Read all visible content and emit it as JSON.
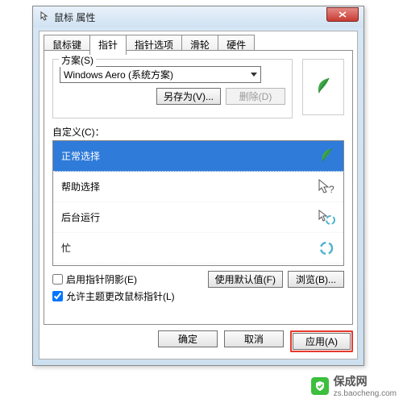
{
  "window": {
    "title": "鼠标 属性"
  },
  "tabs": {
    "t0": "鼠标键",
    "t1": "指针",
    "t2": "指针选项",
    "t3": "滑轮",
    "t4": "硬件",
    "active": 1
  },
  "scheme": {
    "group_label": "方案(S)",
    "selected": "Windows Aero (系统方案)",
    "save_as": "另存为(V)...",
    "delete": "删除(D)"
  },
  "custom": {
    "label": "自定义(C)：",
    "items": [
      {
        "label": "正常选择",
        "icon": "leaf",
        "selected": true
      },
      {
        "label": "帮助选择",
        "icon": "arrow-help",
        "selected": false
      },
      {
        "label": "后台运行",
        "icon": "arrow-spinner",
        "selected": false
      },
      {
        "label": "忙",
        "icon": "spinner",
        "selected": false
      }
    ]
  },
  "checks": {
    "shadow": {
      "label": "启用指针阴影(E)",
      "checked": false
    },
    "theme": {
      "label": "允许主题更改鼠标指针(L)",
      "checked": true
    }
  },
  "defaults_btn": "使用默认值(F)",
  "browse_btn": "浏览(B)...",
  "footer": {
    "ok": "确定",
    "cancel": "取消",
    "apply": "应用(A)"
  },
  "watermark": {
    "text": "保成网",
    "sub": "zs.baocheng.com"
  }
}
